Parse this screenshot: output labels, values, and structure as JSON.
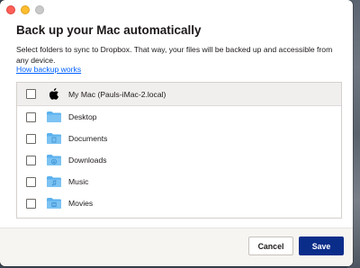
{
  "dialog": {
    "title": "Back up your Mac automatically",
    "description": "Select folders to sync to Dropbox. That way, your files will be backed up and accessible from any device.",
    "link_text": "How backup works"
  },
  "folders": [
    {
      "label": "My Mac (Pauls-iMac-2.local)",
      "icon": "apple-icon",
      "checked": false
    },
    {
      "label": "Desktop",
      "icon": "folder-icon",
      "checked": false
    },
    {
      "label": "Documents",
      "icon": "folder-documents-icon",
      "checked": false
    },
    {
      "label": "Downloads",
      "icon": "folder-downloads-icon",
      "checked": false
    },
    {
      "label": "Music",
      "icon": "folder-music-icon",
      "checked": false
    },
    {
      "label": "Movies",
      "icon": "folder-movies-icon",
      "checked": false
    }
  ],
  "buttons": {
    "cancel": "Cancel",
    "save": "Save"
  },
  "colors": {
    "primary": "#0b2d8a",
    "link": "#0061fe",
    "folder": "#5bb1ee"
  }
}
